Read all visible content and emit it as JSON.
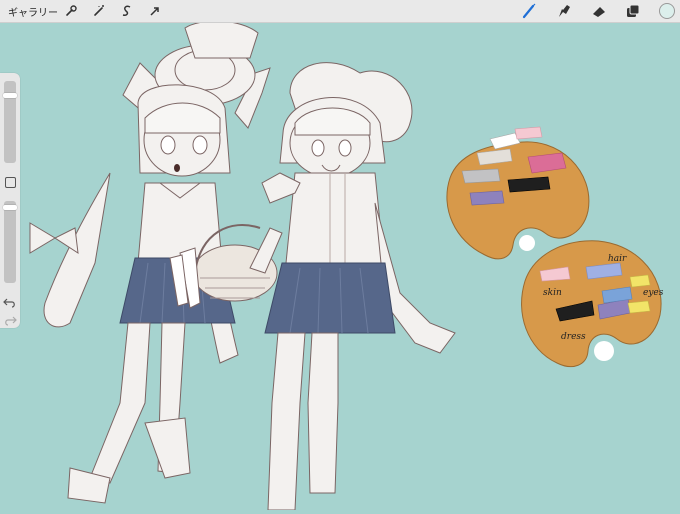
{
  "toolbar": {
    "gallery_label": "ギャラリー",
    "left_tools": [
      "wrench-icon",
      "magic-wand-icon",
      "selection-icon",
      "transform-arrow-icon"
    ],
    "right_tools": [
      "brush-icon",
      "smudge-icon",
      "eraser-icon",
      "layers-icon",
      "color-swatch-icon"
    ],
    "active_tool": "brush",
    "current_color": "#dcefec"
  },
  "sidebar": {
    "brush_size": 0.85,
    "opacity": 0.95
  },
  "palettes": {
    "palette2": {
      "labels": {
        "skin": "skin",
        "hair": "hair",
        "eyes": "eyes",
        "dress": "dress"
      }
    }
  },
  "canvas": {
    "background": "#a6d3cf",
    "palette_wood": "#d7994a"
  }
}
